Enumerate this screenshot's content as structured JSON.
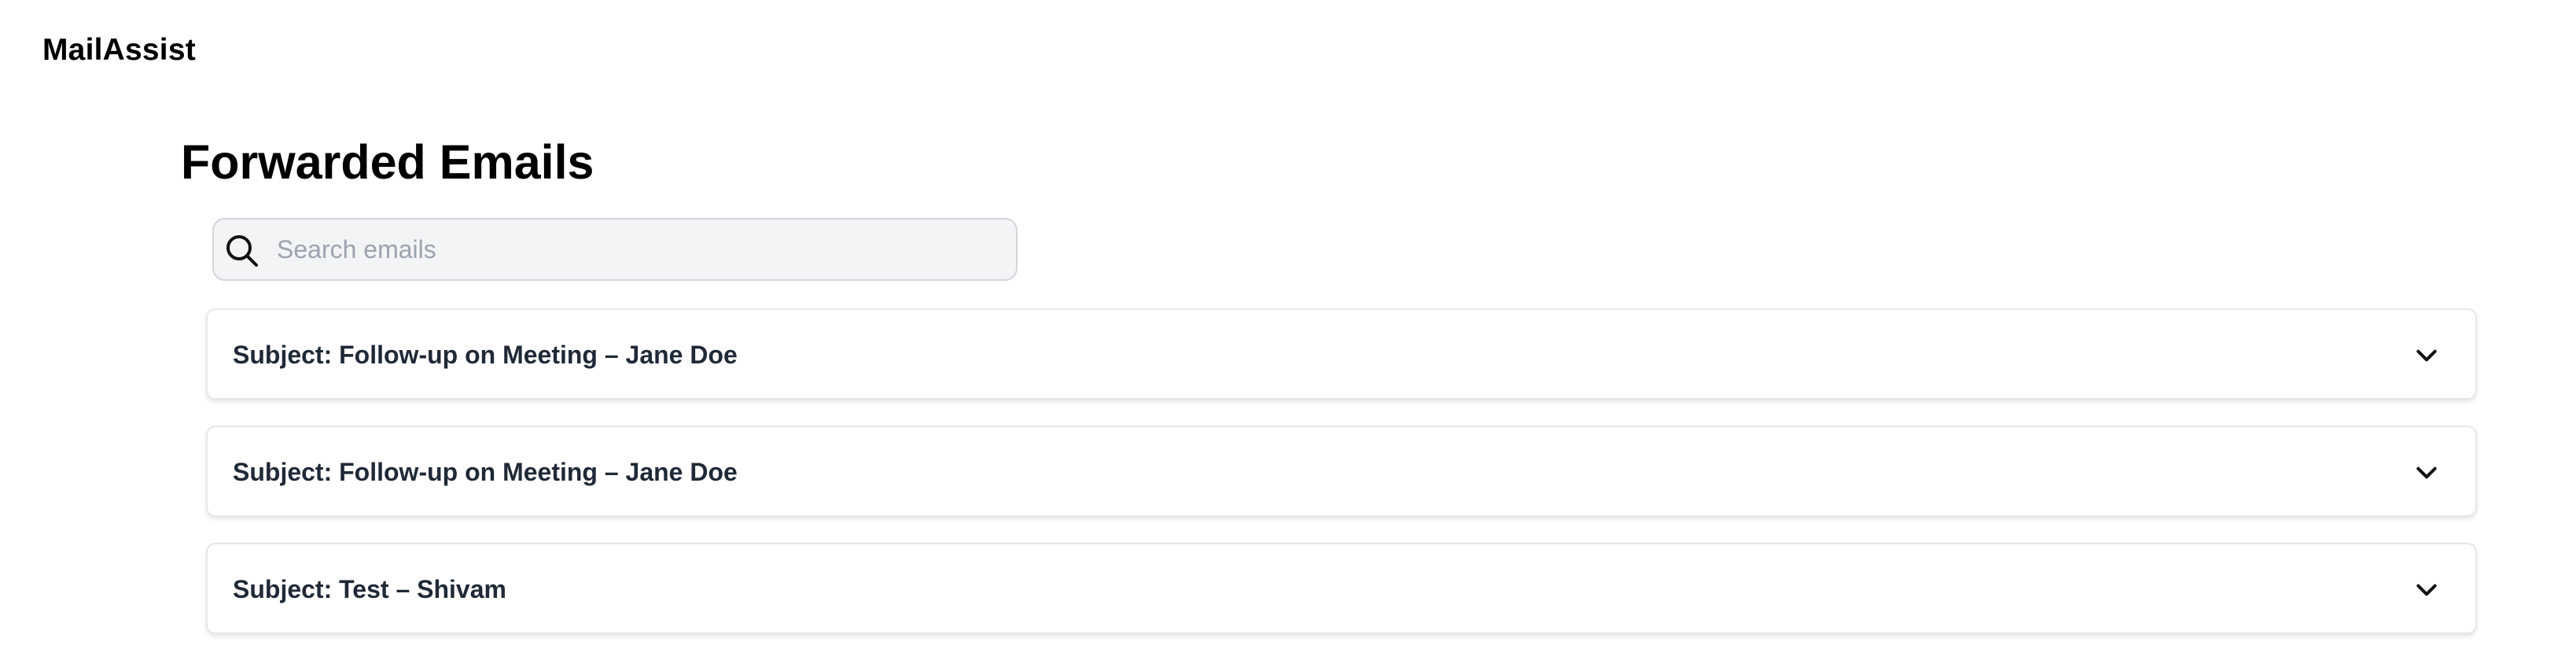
{
  "app": {
    "brand": "MailAssist"
  },
  "main": {
    "title": "Forwarded Emails",
    "search": {
      "placeholder": "Search emails",
      "value": "",
      "icon": "search-icon"
    },
    "emails": [
      {
        "subject": "Subject: Follow-up on Meeting – Jane Doe",
        "expanded": false,
        "icon": "chevron-down-icon"
      },
      {
        "subject": "Subject: Follow-up on Meeting – Jane Doe",
        "expanded": false,
        "icon": "chevron-down-icon"
      },
      {
        "subject": "Subject: Test – Shivam",
        "expanded": false,
        "icon": "chevron-down-icon"
      }
    ]
  },
  "colors": {
    "background": "#ffffff",
    "search_background": "#f3f4f6",
    "text_primary": "#000000",
    "subject_text": "#1f2937",
    "placeholder_text": "#9ca3af"
  }
}
